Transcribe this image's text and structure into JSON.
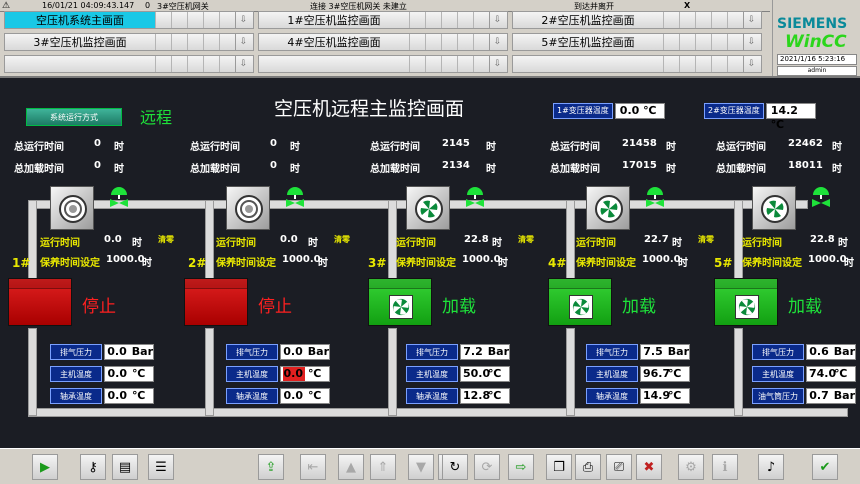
{
  "topbar": {
    "datetime": "16/01/21 04:09:43.147",
    "code": "0",
    "source": "3#空压机网关",
    "connection": "连接 3#空压机网关 未建立",
    "alarm": "到达并离开",
    "close": "X"
  },
  "nav": [
    {
      "label": "空压机系统主画面"
    },
    {
      "label": "1#空压机监控画面"
    },
    {
      "label": "2#空压机监控画面"
    },
    {
      "label": "3#空压机监控画面"
    },
    {
      "label": "4#空压机监控画面"
    },
    {
      "label": "5#空压机监控画面"
    },
    {
      "label": ""
    },
    {
      "label": ""
    },
    {
      "label": ""
    }
  ],
  "logo": {
    "brand": "SIEMENS",
    "product": "WinCC",
    "date": "2021/1/16 5:23:16",
    "user": "admin"
  },
  "main": {
    "title": "空压机远程主监控画面",
    "mode_button": "系统运行方式",
    "mode": "远程",
    "transformer1": {
      "label": "1#变压器温度",
      "value": "0.0",
      "unit": "℃"
    },
    "transformer2": {
      "label": "2#变压器温度",
      "value": "14.2",
      "unit": "℃"
    },
    "labels": {
      "total_run": "总运行时间",
      "total_load": "总加载时间",
      "run_time": "运行时间",
      "maint": "保养时间设定",
      "hour": "时",
      "clear": "清零",
      "exhaust": "排气压力",
      "host_temp": "主机温度",
      "bearing_temp": "轴承温度",
      "oil_pressure": "油气筒压力",
      "bar": "Bar",
      "celsius": "℃"
    },
    "compressors": [
      {
        "id": "1#",
        "total_run": "0",
        "total_load": "0",
        "run": "0.0",
        "maint": "1000.0",
        "status": "停止",
        "pressure": "0.0",
        "host_temp": "0.0",
        "bearing_temp": "0.0",
        "host_alarm": false
      },
      {
        "id": "2#",
        "total_run": "0",
        "total_load": "0",
        "run": "0.0",
        "maint": "1000.0",
        "status": "停止",
        "pressure": "0.0",
        "host_temp": "0.0",
        "bearing_temp": "0.0",
        "host_alarm": true
      },
      {
        "id": "3#",
        "total_run": "2145",
        "total_load": "2134",
        "run": "22.8",
        "maint": "1000.0",
        "status": "加载",
        "pressure": "7.2",
        "host_temp": "50.0",
        "bearing_temp": "12.8",
        "host_alarm": false
      },
      {
        "id": "4#",
        "total_run": "21458",
        "total_load": "17015",
        "run": "22.7",
        "maint": "1000.0",
        "status": "加载",
        "pressure": "7.5",
        "host_temp": "96.7",
        "bearing_temp": "14.9",
        "host_alarm": false
      },
      {
        "id": "5#",
        "total_run": "22462",
        "total_load": "18011",
        "run": "22.8",
        "maint": "1000.0",
        "status": "加载",
        "pressure": "0.6",
        "host_temp": "74.0",
        "bearing_temp": "0.7",
        "host_alarm": false
      }
    ]
  },
  "colors": {
    "running": "#1ee23a",
    "stopped": "#ff2020",
    "label_yellow": "#e8e800",
    "panel_blue": "#0a2a8a"
  },
  "toolbar": [
    "play-icon",
    "key-icon",
    "folder-icon",
    "report-icon",
    "export-icon",
    "first-icon",
    "up-icon",
    "up-page-icon",
    "down-icon",
    "last-icon",
    "refresh-icon",
    "loop-icon",
    "forward-icon",
    "copy-icon",
    "print-icon",
    "print-setup-icon",
    "delete-icon",
    "settings-icon",
    "info-icon",
    "sound-icon",
    "ack-icon"
  ]
}
